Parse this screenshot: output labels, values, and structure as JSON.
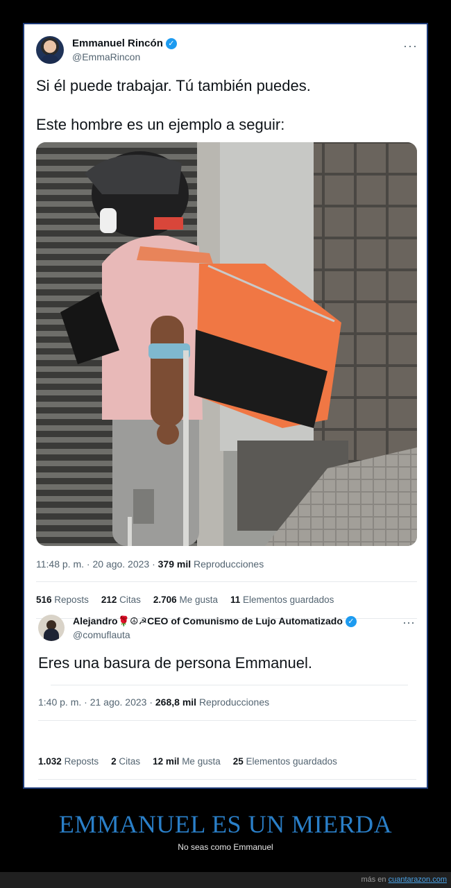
{
  "tweet1": {
    "author_name": "Emmanuel Rincón",
    "handle": "@EmmaRincon",
    "more_icon": "more-dots-icon",
    "text_line1": "Si él puede trabajar. Tú también puedes.",
    "text_line2": "Este hombre es un ejemplo a seguir:",
    "timestamp": "11:48 p. m. · 20 ago. 2023 ·",
    "views_count": "379 mil",
    "views_label": "Reproducciones",
    "stats": [
      {
        "count": "516",
        "label": "Reposts"
      },
      {
        "count": "212",
        "label": "Citas"
      },
      {
        "count": "2.706",
        "label": "Me gusta"
      },
      {
        "count": "11",
        "label": "Elementos guardados"
      }
    ]
  },
  "tweet2": {
    "author_name": "Alejandro🌹☮☭CEO of Comunismo de Lujo Automatizado",
    "handle": "@comuflauta",
    "text": "Eres una basura de persona Emmanuel.",
    "timestamp": "1:40 p. m. · 21 ago. 2023 ·",
    "views_count": "268,8 mil",
    "views_label": "Reproducciones",
    "stats": [
      {
        "count": "1.032",
        "label": "Reposts"
      },
      {
        "count": "2",
        "label": "Citas"
      },
      {
        "count": "12 mil",
        "label": "Me gusta"
      },
      {
        "count": "25",
        "label": "Elementos guardados"
      }
    ]
  },
  "headline": "EMMANUEL ES UN MIERDA",
  "subline": "No seas como Emmanuel",
  "footer": {
    "prefix": "más en",
    "link": "cuantarazon.com"
  },
  "colors": {
    "headline": "#2a7fc8",
    "verified": "#1d9bf0",
    "card_border": "#1d3a78"
  }
}
